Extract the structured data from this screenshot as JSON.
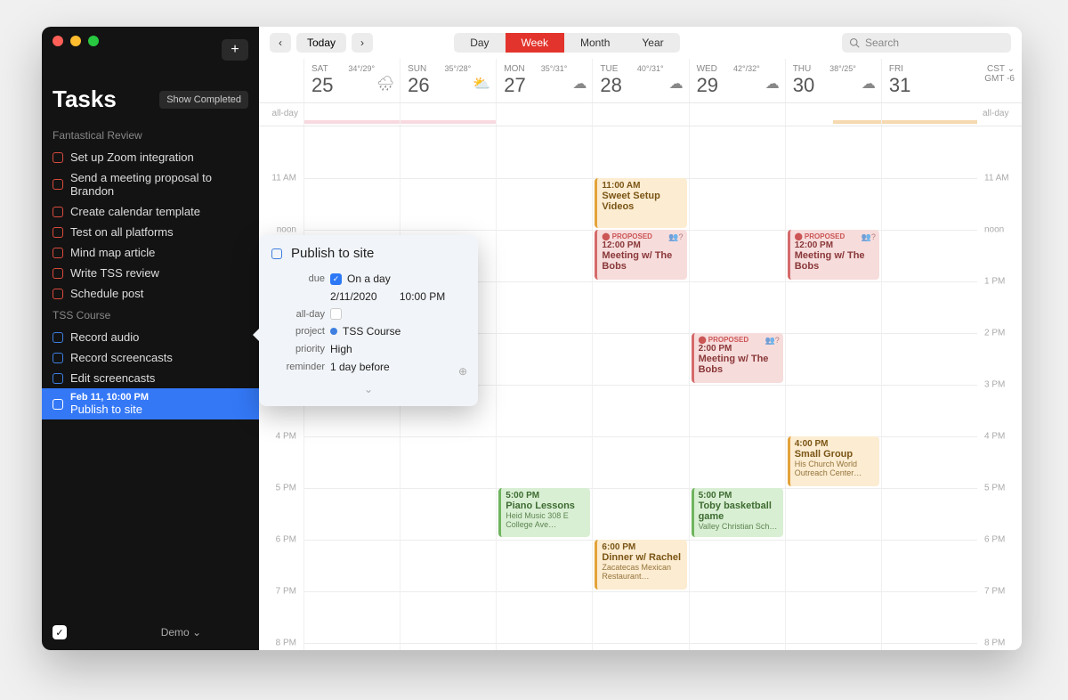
{
  "sidebar": {
    "title": "Tasks",
    "show_completed": "Show Completed",
    "groups": [
      {
        "name": "Fantastical Review",
        "color": "red",
        "tasks": [
          {
            "label": "Set up Zoom integration"
          },
          {
            "label": "Send a meeting proposal to Brandon"
          },
          {
            "label": "Create calendar template"
          },
          {
            "label": "Test on all platforms"
          },
          {
            "label": "Mind map article"
          },
          {
            "label": "Write TSS review"
          },
          {
            "label": "Schedule post"
          }
        ]
      },
      {
        "name": "TSS Course",
        "color": "blue",
        "tasks": [
          {
            "label": "Record audio"
          },
          {
            "label": "Record screencasts"
          },
          {
            "label": "Edit screencasts"
          },
          {
            "label": "Publish to site",
            "sub": "Feb 11, 10:00 PM",
            "selected": true
          }
        ]
      }
    ],
    "footer_label": "Demo"
  },
  "toolbar": {
    "today": "Today",
    "views": [
      "Day",
      "Week",
      "Month",
      "Year"
    ],
    "active_view": "Week",
    "search_placeholder": "Search"
  },
  "timezone": {
    "label": "CST",
    "offset": "GMT -6"
  },
  "allday_label": "all-day",
  "days": [
    {
      "dow": "SAT",
      "num": "25",
      "temp": "34°/29°",
      "icon": "🌧"
    },
    {
      "dow": "SUN",
      "num": "26",
      "temp": "35°/28°",
      "icon": "⛅"
    },
    {
      "dow": "MON",
      "num": "27",
      "temp": "35°/31°",
      "icon": "☁"
    },
    {
      "dow": "TUE",
      "num": "28",
      "temp": "40°/31°",
      "icon": "☁"
    },
    {
      "dow": "WED",
      "num": "29",
      "temp": "42°/32°",
      "icon": "☁"
    },
    {
      "dow": "THU",
      "num": "30",
      "temp": "38°/25°",
      "icon": "☁"
    },
    {
      "dow": "FRI",
      "num": "31",
      "temp": "",
      "icon": ""
    }
  ],
  "hours": [
    "11 AM",
    "noon",
    "",
    "",
    "",
    "4 PM",
    "5 PM",
    "6 PM",
    "7 PM",
    "8 PM"
  ],
  "hours_right": [
    "11 AM",
    "noon",
    "1 PM",
    "2 PM",
    "3 PM",
    "4 PM",
    "5 PM",
    "6 PM",
    "7 PM",
    "8 PM"
  ],
  "events": {
    "tue_11": {
      "time": "11:00 AM",
      "title": "Sweet Setup Videos"
    },
    "tue_12": {
      "proposed": "PROPOSED",
      "time": "12:00 PM",
      "title": "Meeting w/ The Bobs"
    },
    "tue_18": {
      "time": "6:00 PM",
      "title": "Dinner w/ Rachel",
      "sub": "Zacatecas Mexican Restaurant…"
    },
    "wed_14": {
      "proposed": "PROPOSED",
      "time": "2:00 PM",
      "title": "Meeting w/ The Bobs"
    },
    "wed_17": {
      "time": "5:00 PM",
      "title": "Toby basketball game",
      "sub": "Valley Christian Sch…"
    },
    "thu_12": {
      "proposed": "PROPOSED",
      "time": "12:00 PM",
      "title": "Meeting w/ The Bobs"
    },
    "thu_16": {
      "time": "4:00 PM",
      "title": "Small Group",
      "sub": "His Church World Outreach Center…"
    },
    "mon_17": {
      "time": "5:00 PM",
      "title": "Piano Lessons",
      "sub": "Heid Music\n308 E College Ave…"
    }
  },
  "popover": {
    "title": "Publish to site",
    "labels": {
      "due": "due",
      "allday": "all-day",
      "project": "project",
      "priority": "priority",
      "reminder": "reminder"
    },
    "on_a_day": "On a day",
    "date": "2/11/2020",
    "time": "10:00 PM",
    "project": "TSS Course",
    "priority": "High",
    "reminder": "1 day before"
  }
}
